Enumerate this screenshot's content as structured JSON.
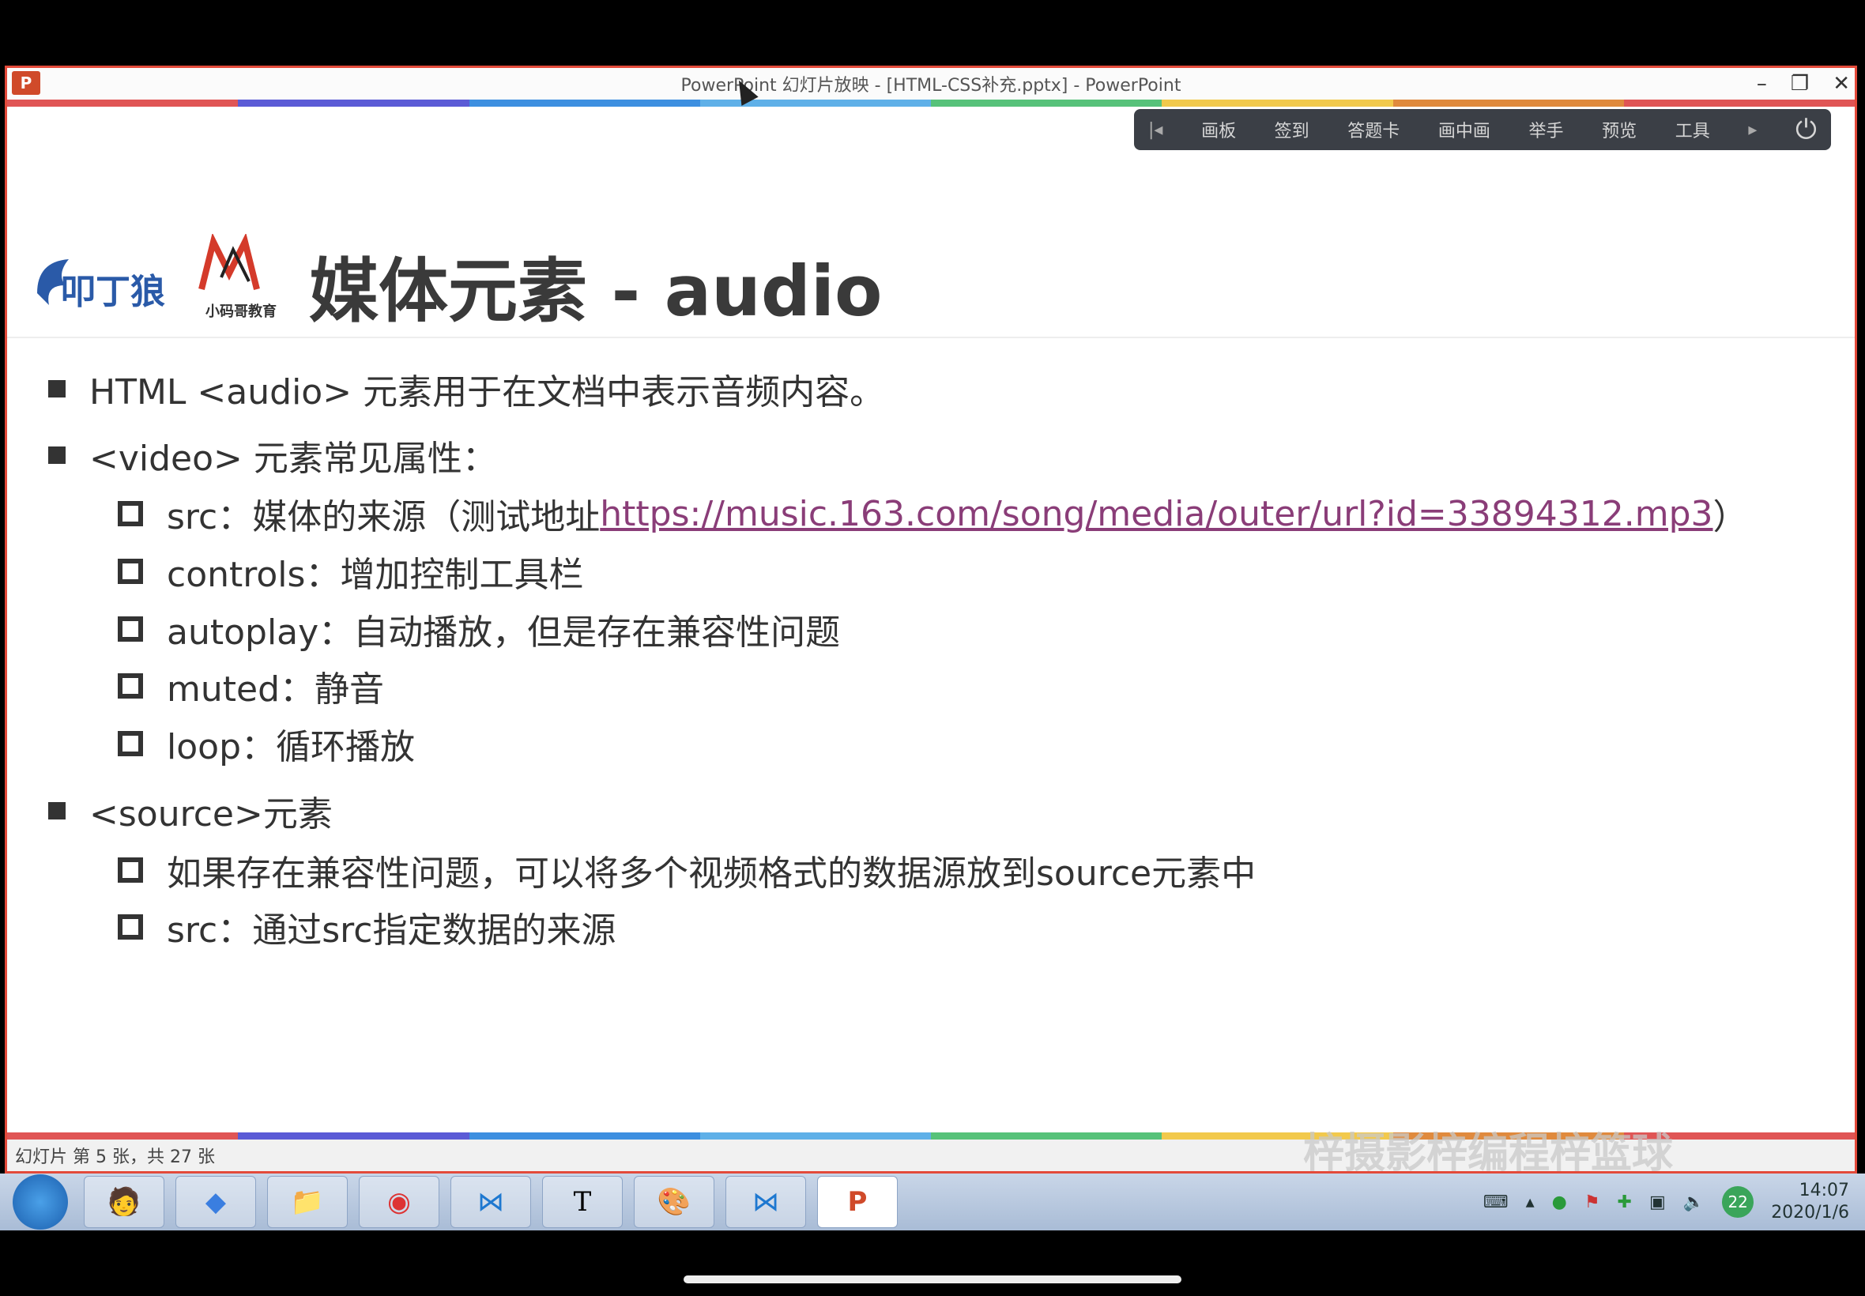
{
  "window": {
    "title": "PowerPoint 幻灯片放映 - [HTML-CSS补充.pptx] - PowerPoint",
    "app_icon": "P",
    "controls": [
      "–",
      "❐",
      "✕"
    ]
  },
  "toolbar": {
    "items": [
      "画板",
      "签到",
      "答题卡",
      "画中画",
      "举手",
      "预览",
      "工具"
    ],
    "prev_icon": "prev-slide-icon",
    "next_icon": "next-slide-icon",
    "power_icon": "power-icon"
  },
  "slide": {
    "title": "媒体元素 - audio",
    "logo_text": "小码哥教育",
    "bullets": [
      {
        "text": "HTML <audio> 元素用于在文档中表示音频内容。"
      },
      {
        "text": "<video> 元素常见属性："
      },
      {
        "text": "<source>元素"
      }
    ],
    "video_items": [
      {
        "prefix": "src：媒体的来源（测试地址",
        "link": "https://music.163.com/song/media/outer/url?id=33894312.mp3",
        "suffix": "）"
      },
      {
        "text": "controls：增加控制工具栏"
      },
      {
        "text": "autoplay：自动播放，但是存在兼容性问题"
      },
      {
        "text": "muted：静音"
      },
      {
        "text": "loop：循环播放"
      }
    ],
    "source_items": [
      {
        "text": "如果存在兼容性问题，可以将多个视频格式的数据源放到source元素中"
      },
      {
        "text": "src：通过src指定数据的来源"
      }
    ]
  },
  "status": {
    "slide_info": "幻灯片 第 5 张，共 27 张",
    "watermark": "梓摄影梓编程梓篮球"
  },
  "taskbar": {
    "apps": [
      "windows-start",
      "user-avatar",
      "app-launcher",
      "file-explorer",
      "chrome",
      "vscode",
      "typora",
      "paint",
      "vscode-2",
      "powerpoint"
    ],
    "tray_badge": "22",
    "time": "14:07",
    "date": "2020/1/6"
  },
  "colors": {
    "window_border": "#e34a3a",
    "link": "#8a3d78",
    "strip": [
      "#e05555",
      "#5b5bd6",
      "#3d8fe0",
      "#5fb0e8",
      "#57c27a",
      "#f2c94c",
      "#e08a3d",
      "#e05555"
    ]
  }
}
